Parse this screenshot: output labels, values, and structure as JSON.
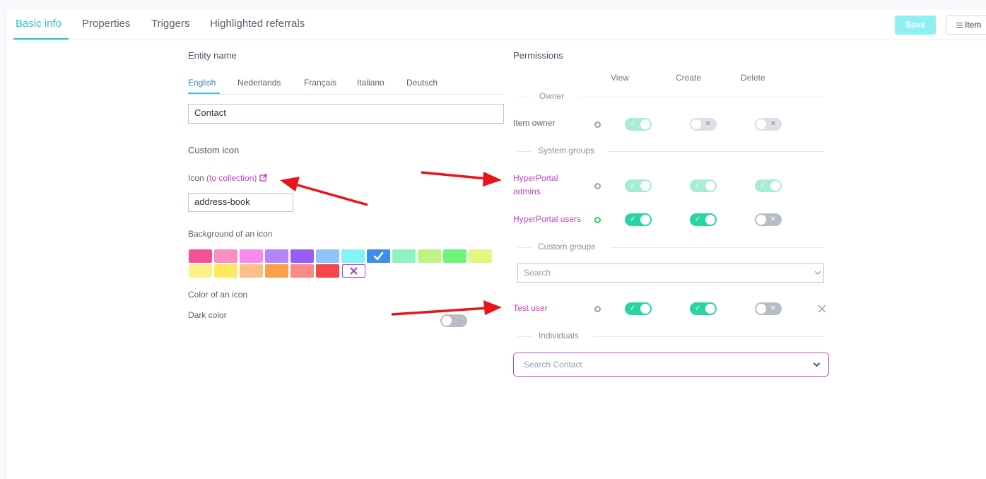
{
  "tabs": [
    {
      "label": "Basic info"
    },
    {
      "label": "Properties"
    },
    {
      "label": "Triggers"
    },
    {
      "label": "Highlighted referrals"
    }
  ],
  "toolbar": {
    "save_label": "Save",
    "items_label": "Item"
  },
  "entity": {
    "title": "Entity name",
    "languages": [
      "English",
      "Nederlands",
      "Français",
      "Italiano",
      "Deutsch"
    ],
    "name_value": "Contact"
  },
  "custom_icon": {
    "title": "Custom icon",
    "icon_label": "Icon",
    "collection_link": "(to collection)",
    "icon_value": "address-book",
    "background_label": "Background of an icon",
    "swatches_row1": [
      "#f7509a",
      "#f98dc4",
      "#f58af0",
      "#b287f5",
      "#9a5cf6",
      "#8ec3fb",
      "#83f4f6",
      "#3b8fe8",
      "#8ef2c3",
      "#bdf482",
      "#6cf57b",
      "#e5f783"
    ],
    "swatches_row2": [
      "#fdf28a",
      "#fbea5f",
      "#fbc08a",
      "#fba04a",
      "#fa8a85",
      "#f3484a"
    ],
    "color_label": "Color of an icon",
    "dark_label": "Dark color"
  },
  "permissions": {
    "title": "Permissions",
    "columns": [
      "View",
      "Create",
      "Delete"
    ],
    "sections": {
      "owner": "Owner",
      "system": "System groups",
      "custom": "Custom groups",
      "individuals": "Individuals"
    },
    "rows": {
      "item_owner": "Item owner",
      "admins_line1": "HyperPortal",
      "admins_line2": "admins",
      "users": "HyperPortal users",
      "test_user": "Test user"
    },
    "search_placeholder": "Search",
    "search_contact_placeholder": "Search Contact"
  },
  "colors": {
    "accent": "#2ec5d6",
    "toggle_on": "#2bd3a3",
    "link": "#c244c9",
    "arrow": "#e8141c"
  }
}
